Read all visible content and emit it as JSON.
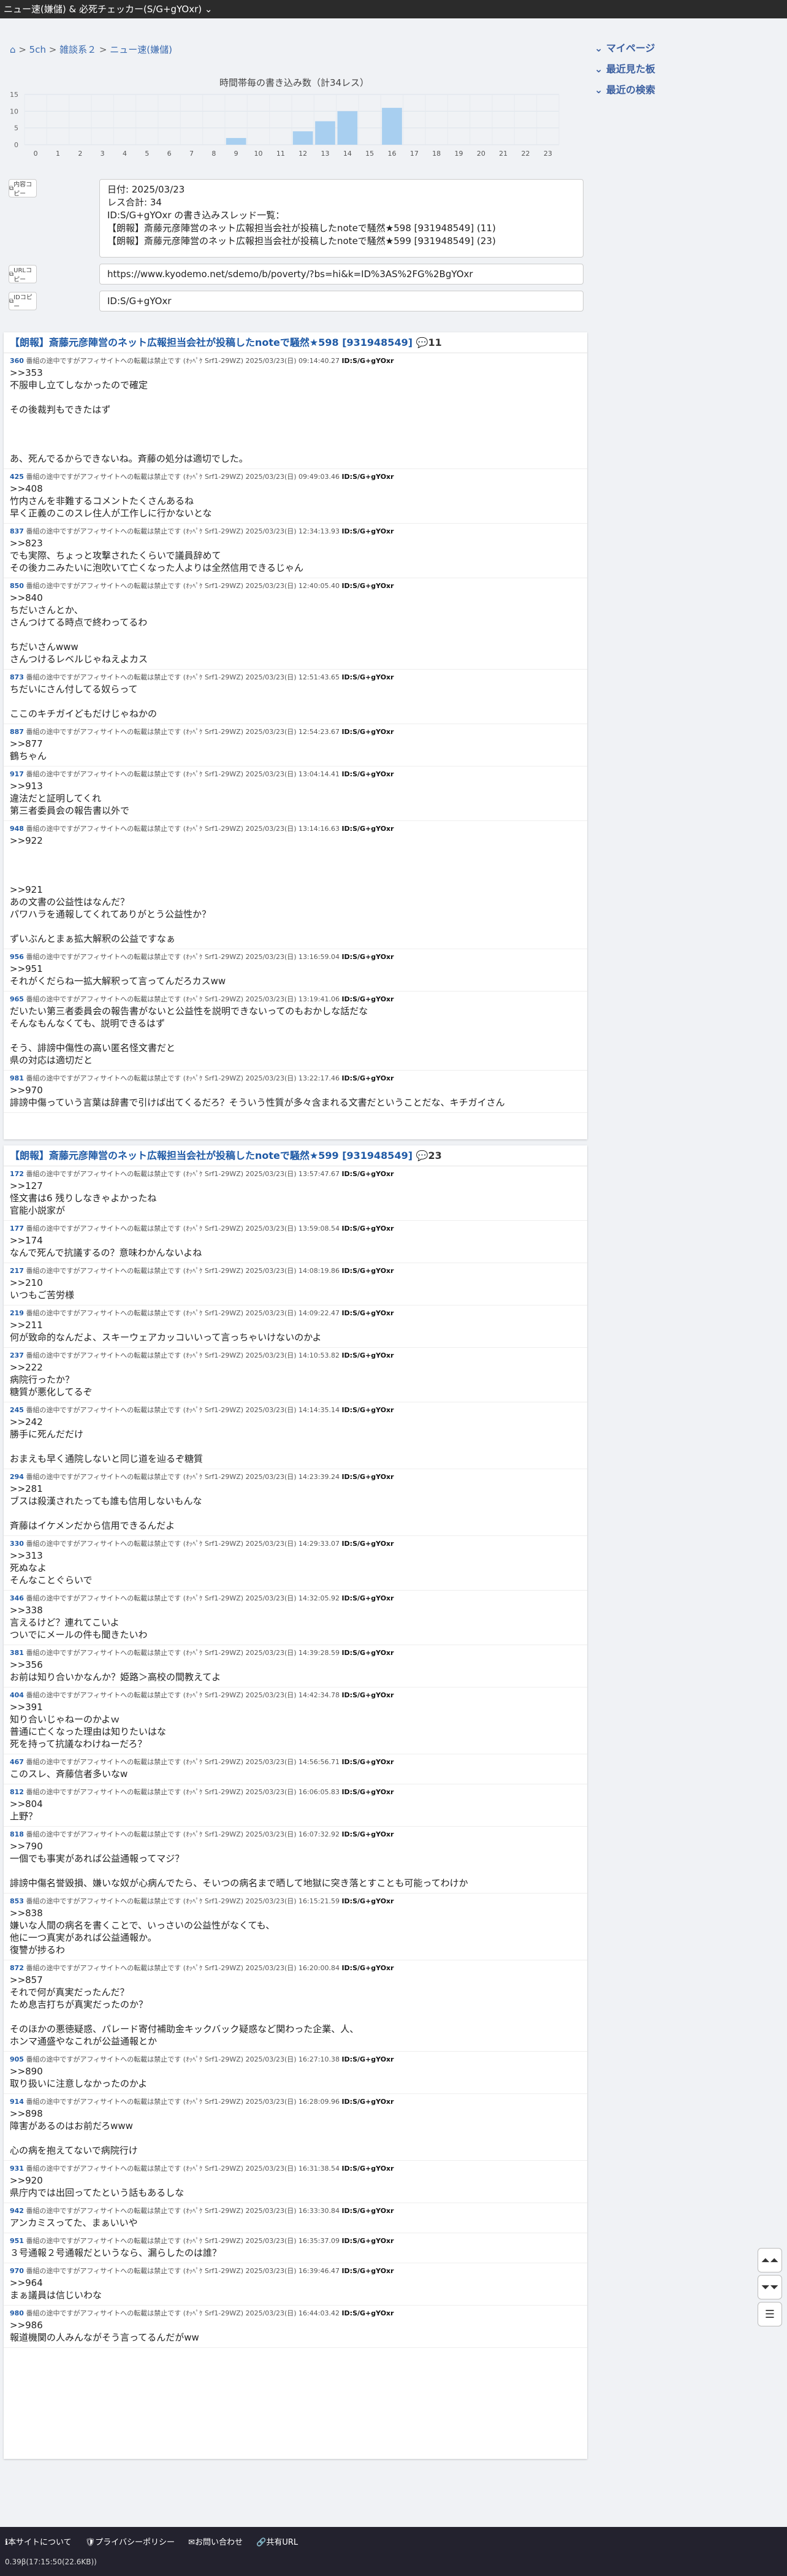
{
  "topbar": {
    "title": "ニュー速(嫌儲) & 必死チェッカー(S/G+gYOxr)"
  },
  "breadcrumb": {
    "home": "⌂",
    "sep1": ">",
    "site": "5ch",
    "sep2": ">",
    "board_group": "雑談系２",
    "sep3": ">",
    "board": "ニュー速(嫌儲)"
  },
  "sidebar": {
    "items": [
      {
        "label": "マイページ"
      },
      {
        "label": "最近見た板"
      },
      {
        "label": "最近の検索"
      }
    ]
  },
  "chart_data": {
    "type": "bar",
    "title": "時間帯毎の書き込み数（計34レス）",
    "categories": [
      "0",
      "1",
      "2",
      "3",
      "4",
      "5",
      "6",
      "7",
      "8",
      "9",
      "10",
      "11",
      "12",
      "13",
      "14",
      "15",
      "16",
      "17",
      "18",
      "19",
      "20",
      "21",
      "22",
      "23"
    ],
    "values": [
      0,
      0,
      0,
      0,
      0,
      0,
      0,
      0,
      0,
      2,
      0,
      0,
      4,
      7,
      10,
      0,
      11,
      0,
      0,
      0,
      0,
      0,
      0,
      0
    ],
    "ylim": [
      0,
      15
    ],
    "yticks": [
      "0",
      "5",
      "10",
      "15"
    ],
    "grid": true,
    "color": "#a8cff0"
  },
  "tools": {
    "content_btn": "内容コピー",
    "url_btn": "URLコピー",
    "id_btn": "IDコピー"
  },
  "summary": {
    "lines": [
      "日付: 2025/03/23",
      "レス合計: 34",
      "ID:S/G+gYOxr の書き込みスレッド一覧：",
      "【朗報】斎藤元彦陣営のネット広報担当会社が投稿したnoteで騒然★598 [931948549] (11)",
      "【朗報】斎藤元彦陣営のネット広報担当会社が投稿したnoteで騒然★599 [931948549] (23)"
    ]
  },
  "url_field": {
    "value": "https://www.kyodemo.net/sdemo/b/poverty/?bs=hi&k=ID%3AS%2FG%2BgYOxr"
  },
  "id_field": {
    "value": "ID:S/G+gYOxr"
  },
  "threads": [
    {
      "title": "【朗報】斎藤元彦陣営のネット広報担当会社が投稿したnoteで騒然★598 [931948549]",
      "count_icon": "💬",
      "count": "11",
      "posts": [
        {
          "num": "360",
          "meta": " 番組の途中ですがアフィサイトへの転載は禁止です (ｵｯﾍﾟｹ Srf1-29WZ) 2025/03/23(日) 09:14:40.27 ",
          "uid": "ID:S/G+gYOxr",
          "body": ">>353\n不服申し立てしなかったので確定\n\nその後裁判もできたはず\n\n\n\nあ、死んでるからできないね。斉藤の処分は適切でした。"
        },
        {
          "num": "425",
          "meta": " 番組の途中ですがアフィサイトへの転載は禁止です (ｵｯﾍﾟｹ Srf1-29WZ) 2025/03/23(日) 09:49:03.46 ",
          "uid": "ID:S/G+gYOxr",
          "body": ">>408\n竹内さんを非難するコメントたくさんあるね\n早く正義のこのスレ住人が工作しに行かないとな"
        },
        {
          "num": "837",
          "meta": " 番組の途中ですがアフィサイトへの転載は禁止です (ｵｯﾍﾟｹ Srf1-29WZ) 2025/03/23(日) 12:34:13.93 ",
          "uid": "ID:S/G+gYOxr",
          "body": ">>823\nでも実際、ちょっと攻撃されたくらいで議員辞めて\nその後カニみたいに泡吹いて亡くなった人よりは全然信用できるじゃん"
        },
        {
          "num": "850",
          "meta": " 番組の途中ですがアフィサイトへの転載は禁止です (ｵｯﾍﾟｹ Srf1-29WZ) 2025/03/23(日) 12:40:05.40 ",
          "uid": "ID:S/G+gYOxr",
          "body": ">>840\nちだいさんとか、\nさんつけてる時点で終わってるわ\n\nちだいさんwww\nさんつけるレベルじゃねえよカス"
        },
        {
          "num": "873",
          "meta": " 番組の途中ですがアフィサイトへの転載は禁止です (ｵｯﾍﾟｹ Srf1-29WZ) 2025/03/23(日) 12:51:43.65 ",
          "uid": "ID:S/G+gYOxr",
          "body": "ちだいにさん付してる奴らって\n\nここのキチガイどもだけじゃねかの"
        },
        {
          "num": "887",
          "meta": " 番組の途中ですがアフィサイトへの転載は禁止です (ｵｯﾍﾟｹ Srf1-29WZ) 2025/03/23(日) 12:54:23.67 ",
          "uid": "ID:S/G+gYOxr",
          "body": ">>877\n鶴ちゃん"
        },
        {
          "num": "917",
          "meta": " 番組の途中ですがアフィサイトへの転載は禁止です (ｵｯﾍﾟｹ Srf1-29WZ) 2025/03/23(日) 13:04:14.41 ",
          "uid": "ID:S/G+gYOxr",
          "body": ">>913\n違法だと証明してくれ\n第三者委員会の報告書以外で"
        },
        {
          "num": "948",
          "meta": " 番組の途中ですがアフィサイトへの転載は禁止です (ｵｯﾍﾟｹ Srf1-29WZ) 2025/03/23(日) 13:14:16.63 ",
          "uid": "ID:S/G+gYOxr",
          "body": ">>922\n\n\n\n>>921\nあの文書の公益性はなんだ？\nパワハラを通報してくれてありがとう公益性か？\n\nずいぶんとまぁ拡大解釈の公益ですなぁ"
        },
        {
          "num": "956",
          "meta": " 番組の途中ですがアフィサイトへの転載は禁止です (ｵｯﾍﾟｹ Srf1-29WZ) 2025/03/23(日) 13:16:59.04 ",
          "uid": "ID:S/G+gYOxr",
          "body": ">>951\nそれがくだらね一拡大解釈って言ってんだろカスww"
        },
        {
          "num": "965",
          "meta": " 番組の途中ですがアフィサイトへの転載は禁止です (ｵｯﾍﾟｹ Srf1-29WZ) 2025/03/23(日) 13:19:41.06 ",
          "uid": "ID:S/G+gYOxr",
          "body": "だいたい第三者委員会の報告書がないと公益性を説明できないってのもおかしな話だな\nそんなもんなくても、説明できるはず\n\nそう、誹謗中傷性の高い匿名怪文書だと\n県の対応は適切だと"
        },
        {
          "num": "981",
          "meta": " 番組の途中ですがアフィサイトへの転載は禁止です (ｵｯﾍﾟｹ Srf1-29WZ) 2025/03/23(日) 13:22:17.46 ",
          "uid": "ID:S/G+gYOxr",
          "body": ">>970\n誹謗中傷っていう言葉は辞書で引けば出てくるだろ？そういう性質が多々含まれる文書だということだな、キチガイさん"
        }
      ]
    },
    {
      "title": "【朗報】斎藤元彦陣営のネット広報担当会社が投稿したnoteで騒然★599 [931948549]",
      "count_icon": "💬",
      "count": "23",
      "posts": [
        {
          "num": "172",
          "meta": " 番組の途中ですがアフィサイトへの転載は禁止です (ｵｯﾍﾟｹ Srf1-29WZ) 2025/03/23(日) 13:57:47.67 ",
          "uid": "ID:S/G+gYOxr",
          "body": ">>127\n怪文書は6 残りしなきゃよかったね\n官能小説家が"
        },
        {
          "num": "177",
          "meta": " 番組の途中ですがアフィサイトへの転載は禁止です (ｵｯﾍﾟｹ Srf1-29WZ) 2025/03/23(日) 13:59:08.54 ",
          "uid": "ID:S/G+gYOxr",
          "body": ">>174\nなんで死んで抗議するの？意味わかんないよね"
        },
        {
          "num": "217",
          "meta": " 番組の途中ですがアフィサイトへの転載は禁止です (ｵｯﾍﾟｹ Srf1-29WZ) 2025/03/23(日) 14:08:19.86 ",
          "uid": "ID:S/G+gYOxr",
          "body": ">>210\nいつもご苦労様"
        },
        {
          "num": "219",
          "meta": " 番組の途中ですがアフィサイトへの転載は禁止です (ｵｯﾍﾟｹ Srf1-29WZ) 2025/03/23(日) 14:09:22.47 ",
          "uid": "ID:S/G+gYOxr",
          "body": ">>211\n何が致命的なんだよ、スキーウェアカッコいいって言っちゃいけないのかよ"
        },
        {
          "num": "237",
          "meta": " 番組の途中ですがアフィサイトへの転載は禁止です (ｵｯﾍﾟｹ Srf1-29WZ) 2025/03/23(日) 14:10:53.82 ",
          "uid": "ID:S/G+gYOxr",
          "body": ">>222\n病院行ったか？\n糖質が悪化してるぞ"
        },
        {
          "num": "245",
          "meta": " 番組の途中ですがアフィサイトへの転載は禁止です (ｵｯﾍﾟｹ Srf1-29WZ) 2025/03/23(日) 14:14:35.14 ",
          "uid": "ID:S/G+gYOxr",
          "body": ">>242\n勝手に死んだだけ\n\nおまえも早く通院しないと同じ道を辿るぞ糖質"
        },
        {
          "num": "294",
          "meta": " 番組の途中ですがアフィサイトへの転載は禁止です (ｵｯﾍﾟｹ Srf1-29WZ) 2025/03/23(日) 14:23:39.24 ",
          "uid": "ID:S/G+gYOxr",
          "body": ">>281\nブスは殺漢されたっても誰も信用しないもんな\n\n斉藤はイケメンだから信用できるんだよ"
        },
        {
          "num": "330",
          "meta": " 番組の途中ですがアフィサイトへの転載は禁止です (ｵｯﾍﾟｹ Srf1-29WZ) 2025/03/23(日) 14:29:33.07 ",
          "uid": "ID:S/G+gYOxr",
          "body": ">>313\n死ぬなよ\nそんなことぐらいで"
        },
        {
          "num": "346",
          "meta": " 番組の途中ですがアフィサイトへの転載は禁止です (ｵｯﾍﾟｹ Srf1-29WZ) 2025/03/23(日) 14:32:05.92 ",
          "uid": "ID:S/G+gYOxr",
          "body": ">>338\n言えるけど？連れてこいよ\nついでにメールの件も聞きたいわ"
        },
        {
          "num": "381",
          "meta": " 番組の途中ですがアフィサイトへの転載は禁止です (ｵｯﾍﾟｹ Srf1-29WZ) 2025/03/23(日) 14:39:28.59 ",
          "uid": "ID:S/G+gYOxr",
          "body": ">>356\nお前は知り合いかなんか？姫路＞高校の間教えてよ"
        },
        {
          "num": "404",
          "meta": " 番組の途中ですがアフィサイトへの転載は禁止です (ｵｯﾍﾟｹ Srf1-29WZ) 2025/03/23(日) 14:42:34.78 ",
          "uid": "ID:S/G+gYOxr",
          "body": ">>391\n知り合いじゃねーのかよｗ\n普通に亡くなった理由は知りたいはな\n死を持って抗議なわけねーだろ？"
        },
        {
          "num": "467",
          "meta": " 番組の途中ですがアフィサイトへの転載は禁止です (ｵｯﾍﾟｹ Srf1-29WZ) 2025/03/23(日) 14:56:56.71 ",
          "uid": "ID:S/G+gYOxr",
          "body": "このスレ、斉藤信者多いなw"
        },
        {
          "num": "812",
          "meta": " 番組の途中ですがアフィサイトへの転載は禁止です (ｵｯﾍﾟｹ Srf1-29WZ) 2025/03/23(日) 16:06:05.83 ",
          "uid": "ID:S/G+gYOxr",
          "body": ">>804\n上野？"
        },
        {
          "num": "818",
          "meta": " 番組の途中ですがアフィサイトへの転載は禁止です (ｵｯﾍﾟｹ Srf1-29WZ) 2025/03/23(日) 16:07:32.92 ",
          "uid": "ID:S/G+gYOxr",
          "body": ">>790\n一個でも事実があれば公益通報ってマジ？\n\n誹謗中傷名誉毀損、嫌いな奴が心病んでたら、そいつの病名まで晒して地獄に突き落とすことも可能ってわけか"
        },
        {
          "num": "853",
          "meta": " 番組の途中ですがアフィサイトへの転載は禁止です (ｵｯﾍﾟｹ Srf1-29WZ) 2025/03/23(日) 16:15:21.59 ",
          "uid": "ID:S/G+gYOxr",
          "body": ">>838\n嫌いな人間の病名を書くことで、いっさいの公益性がなくても、\n他に一つ真実があれば公益通報か。\n復讐が捗るわ"
        },
        {
          "num": "872",
          "meta": " 番組の途中ですがアフィサイトへの転載は禁止です (ｵｯﾍﾟｹ Srf1-29WZ) 2025/03/23(日) 16:20:00.84 ",
          "uid": "ID:S/G+gYOxr",
          "body": ">>857\nそれで何が真実だったんだ？\nため息吉打ちが真実だったのか？\n\nそのほかの悪徳疑惑、パレード寄付補助金キックバック疑惑など関わった企業、人、\nホンマ通盛やなこれが公益通報とか"
        },
        {
          "num": "905",
          "meta": " 番組の途中ですがアフィサイトへの転載は禁止です (ｵｯﾍﾟｹ Srf1-29WZ) 2025/03/23(日) 16:27:10.38 ",
          "uid": "ID:S/G+gYOxr",
          "body": ">>890\n取り扱いに注意しなかったのかよ"
        },
        {
          "num": "914",
          "meta": " 番組の途中ですがアフィサイトへの転載は禁止です (ｵｯﾍﾟｹ Srf1-29WZ) 2025/03/23(日) 16:28:09.96 ",
          "uid": "ID:S/G+gYOxr",
          "body": ">>898\n障害があるのはお前だろwww\n\n心の病を抱えてないで病院行け"
        },
        {
          "num": "931",
          "meta": " 番組の途中ですがアフィサイトへの転載は禁止です (ｵｯﾍﾟｹ Srf1-29WZ) 2025/03/23(日) 16:31:38.54 ",
          "uid": "ID:S/G+gYOxr",
          "body": ">>920\n県庁内では出回ってたという話もあるしな"
        },
        {
          "num": "942",
          "meta": " 番組の途中ですがアフィサイトへの転載は禁止です (ｵｯﾍﾟｹ Srf1-29WZ) 2025/03/23(日) 16:33:30.84 ",
          "uid": "ID:S/G+gYOxr",
          "body": "アンカミスってた、まぁいいや"
        },
        {
          "num": "951",
          "meta": " 番組の途中ですがアフィサイトへの転載は禁止です (ｵｯﾍﾟｹ Srf1-29WZ) 2025/03/23(日) 16:35:37.09 ",
          "uid": "ID:S/G+gYOxr",
          "body": "３号通報２号通報だというなら、漏らしたのは誰？"
        },
        {
          "num": "970",
          "meta": " 番組の途中ですがアフィサイトへの転載は禁止です (ｵｯﾍﾟｹ Srf1-29WZ) 2025/03/23(日) 16:39:46.47 ",
          "uid": "ID:S/G+gYOxr",
          "body": ">>964\nまぁ議員は信じいわな"
        },
        {
          "num": "980",
          "meta": " 番組の途中ですがアフィサイトへの転載は禁止です (ｵｯﾍﾟｹ Srf1-29WZ) 2025/03/23(日) 16:44:03.42 ",
          "uid": "ID:S/G+gYOxr",
          "body": ">>986\n報道機関の人みんながそう言ってるんだがww"
        }
      ]
    }
  ],
  "fabs": {
    "up": "⏶⏶",
    "down": "⏷⏷",
    "menu": "☰"
  },
  "footer": {
    "links": [
      "ℹ本サイトについて",
      "🛡プライバシーポリシー",
      "✉お問い合わせ",
      "🔗共有URL"
    ],
    "version": "0.39β(17:15:50(22.6KB))"
  }
}
